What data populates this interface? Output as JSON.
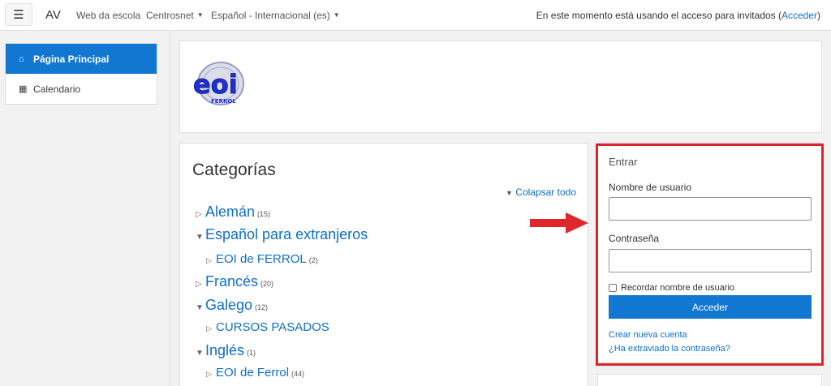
{
  "navbar": {
    "brand": "AV",
    "links": [
      {
        "label": "Web da escola",
        "dropdown": false
      },
      {
        "label": "Centrosnet",
        "dropdown": true
      },
      {
        "label": "Español - Internacional (es)",
        "dropdown": true
      }
    ],
    "guest_prefix": "En este momento está usando el acceso para invitados (",
    "guest_link": "Acceder",
    "guest_suffix": ")"
  },
  "drawer": {
    "items": [
      {
        "label": "Página Principal",
        "icon": "home-icon",
        "active": true
      },
      {
        "label": "Calendario",
        "icon": "calendar-icon",
        "active": false
      }
    ]
  },
  "header": {
    "logo_text": "eoi",
    "logo_sub": "FERROL"
  },
  "categories": {
    "title": "Categorías",
    "collapse_all": "Colapsar todo",
    "items": [
      {
        "label": "Alemán",
        "count": "(15)",
        "level": 0,
        "expanded": false
      },
      {
        "label": "Español para extranjeros",
        "count": "",
        "level": 0,
        "expanded": true
      },
      {
        "label": "EOI de FERROL",
        "count": "(2)",
        "level": 1,
        "expanded": false
      },
      {
        "label": "Francés",
        "count": "(20)",
        "level": 0,
        "expanded": false
      },
      {
        "label": "Galego",
        "count": "(12)",
        "level": 0,
        "expanded": true
      },
      {
        "label": "CURSOS PASADOS",
        "count": "",
        "level": 1,
        "expanded": false
      },
      {
        "label": "Inglés",
        "count": "(1)",
        "level": 0,
        "expanded": true
      },
      {
        "label": "EOI de Ferrol",
        "count": "(44)",
        "level": 1,
        "expanded": false
      }
    ]
  },
  "login": {
    "title": "Entrar",
    "username_label": "Nombre de usuario",
    "password_label": "Contraseña",
    "remember_label": "Recordar nombre de usuario",
    "submit_label": "Acceder",
    "create_account": "Crear nueva cuenta",
    "forgot_password": "¿Ha extraviado la contraseña?"
  },
  "colors": {
    "primary": "#1177d1",
    "link": "#0f6fc5",
    "annotation": "#d9262d"
  }
}
